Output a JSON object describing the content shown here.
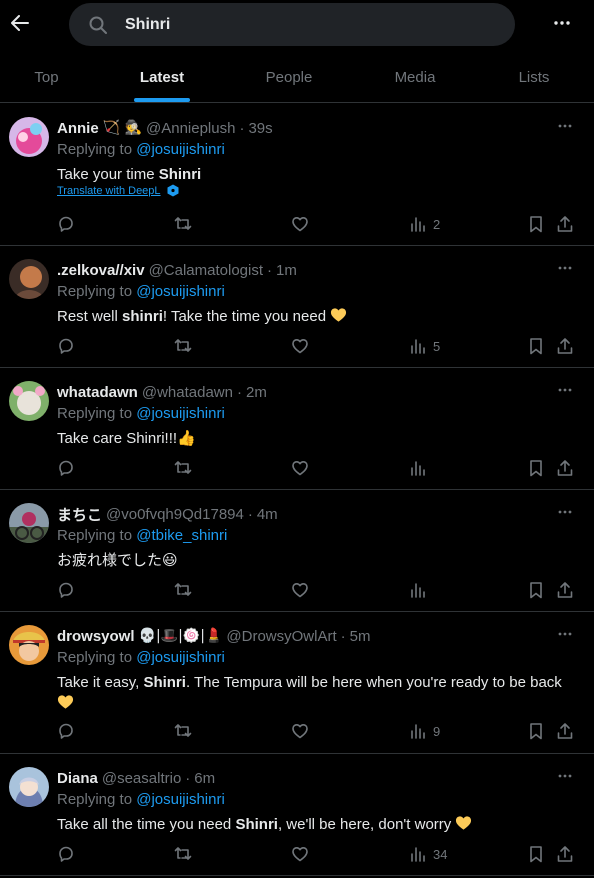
{
  "search": {
    "value": "Shinri"
  },
  "tabs": [
    {
      "label": "Top"
    },
    {
      "label": "Latest"
    },
    {
      "label": "People"
    },
    {
      "label": "Media"
    },
    {
      "label": "Lists"
    }
  ],
  "icons": {
    "back": "arrow-left-icon",
    "search": "search-icon",
    "more": "more-horizontal-icon",
    "reply": "reply-icon",
    "retweet": "retweet-icon",
    "like": "heart-icon",
    "views": "views-icon",
    "bookmark": "bookmark-icon",
    "share": "share-icon"
  },
  "colors": {
    "accent": "#1d9bf0",
    "background": "#000000",
    "muted": "#71767b",
    "text": "#e7e9ea",
    "divider": "#2f3336"
  },
  "reply_prefix": "Replying to",
  "tweets": [
    {
      "name": "Annie",
      "name_emoji": "🏹 🕵",
      "handle": "@Annieplush",
      "time": "39s",
      "reply_to": "@josuijishinri",
      "text_parts": [
        "Take your time ",
        "Shinri"
      ],
      "translate": "Translate with DeepL",
      "views": "2"
    },
    {
      "name": ".zelkova//xiv",
      "name_emoji": "",
      "handle": "@Calamatologist",
      "time": "1m",
      "reply_to": "@josuijishinri",
      "text_parts": [
        "Rest well ",
        "shinri",
        "! Take the time you need "
      ],
      "views": "5"
    },
    {
      "name": "whatadawn",
      "name_emoji": "",
      "handle": "@whatadawn",
      "time": "2m",
      "reply_to": "@josuijishinri",
      "text_parts": [
        "Take care Shinri!!!👍"
      ],
      "views": ""
    },
    {
      "name": "まちこ",
      "name_emoji": "",
      "handle": "@vo0fvqh9Qd17894",
      "time": "4m",
      "reply_to": "@tbike_shinri",
      "text_parts": [
        "お疲れ様でした😃"
      ],
      "views": ""
    },
    {
      "name": "drowsyowl",
      "name_emoji": "💀|🎩|🍥|💄",
      "handle": "@DrowsyOwlArt",
      "time": "5m",
      "reply_to": "@josuijishinri",
      "text_parts": [
        "Take it easy, ",
        "Shinri",
        ". The Tempura will be here when you're ready to be back "
      ],
      "views": "9"
    },
    {
      "name": "Diana",
      "name_emoji": "",
      "handle": "@seasaltrio",
      "time": "6m",
      "reply_to": "@josuijishinri",
      "text_parts": [
        "Take all the time you need ",
        "Shinri",
        ", we'll be here, don't worry "
      ],
      "views": "34"
    }
  ]
}
